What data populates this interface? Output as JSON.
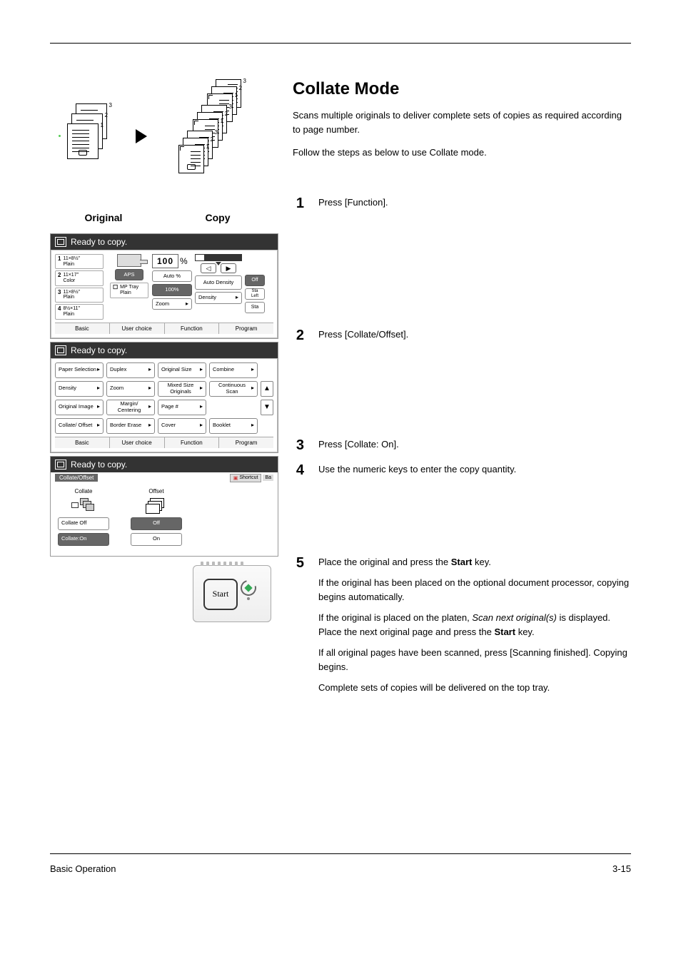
{
  "section_title": "Collate Mode",
  "intro": [
    "Scans multiple originals to deliver complete sets of copies as required according to page number.",
    "Follow the steps as below to use Collate mode."
  ],
  "labels": {
    "original": "Original",
    "copy": "Copy"
  },
  "steps": [
    {
      "n": "1",
      "text": "Press [Function]."
    },
    {
      "n": "2",
      "text": "Press [Collate/Offset]."
    },
    {
      "n": "3",
      "text": "Press [Collate: On]."
    },
    {
      "n": "4",
      "text": "Use the numeric keys to enter the copy quantity."
    }
  ],
  "step5": {
    "n": "5",
    "paras": [
      [
        "Place the original and press the ",
        "Start",
        " key."
      ],
      [
        "If the original has been placed on the optional document processor, copying begins automatically."
      ],
      [
        "If the original is placed on the platen, ",
        "Scan next original(s)",
        " is displayed. Place the next original page and press the ",
        "Start",
        " key."
      ],
      [
        "If all original pages have been scanned, press [Scanning finished]. Copying begins."
      ],
      [
        "Complete sets of copies will be delivered on the top tray."
      ]
    ]
  },
  "screen_header": "Ready to copy.",
  "panel1": {
    "trays": [
      {
        "n": "1",
        "size": "11×8½\"",
        "type": "Plain"
      },
      {
        "n": "2",
        "size": "11×17\"",
        "type": "Color"
      },
      {
        "n": "3",
        "size": "11×8½\"",
        "type": "Plain"
      },
      {
        "n": "4",
        "size": "8½×11\"",
        "type": "Plain"
      }
    ],
    "aps": "APS",
    "mp_tray": "MP Tray",
    "mp_type": "Plain",
    "zoom_value": "100",
    "pct": "%",
    "auto_pct": "Auto %",
    "hundred": "100%",
    "zoom": "Zoom",
    "auto_density": "Auto Density",
    "density": "Density",
    "off": "Off",
    "staple_left": "Sta Left",
    "staple": "Sta",
    "tabs": [
      "Basic",
      "User choice",
      "Function",
      "Program"
    ]
  },
  "panel2": {
    "buttons": [
      [
        "Paper Selection",
        "Duplex",
        "Original Size",
        "Combine",
        ""
      ],
      [
        "Density",
        "Zoom",
        "Mixed Size Originals",
        "Continuous Scan",
        "▲"
      ],
      [
        "Original Image",
        "Margin/ Centering",
        "Page #",
        "",
        "▼"
      ],
      [
        "Collate/ Offset",
        "Border Erase",
        "Cover",
        "Booklet",
        ""
      ]
    ],
    "tabs": [
      "Basic",
      "User choice",
      "Function",
      "Program"
    ]
  },
  "panel3": {
    "title": "Collate/Offset",
    "shortcut": "Shortcut",
    "ba": "Ba",
    "col_collate": "Collate",
    "col_offset": "Offset",
    "collate_off": "Collate Off",
    "collate_on": "Collate:On",
    "off": "Off",
    "on": "On"
  },
  "start_label": "Start",
  "footer_left": "Basic Operation",
  "footer_right": "3-15"
}
